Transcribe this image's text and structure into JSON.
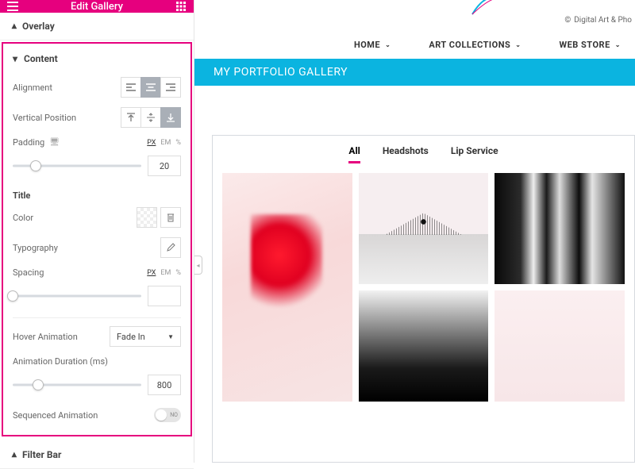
{
  "sidebar": {
    "title": "Edit Gallery",
    "sections": {
      "overlay": "Overlay",
      "content": "Content",
      "filter_bar": "Filter Bar"
    },
    "content": {
      "alignment_label": "Alignment",
      "vertical_position_label": "Vertical Position",
      "padding_label": "Padding",
      "padding_units": {
        "px": "PX",
        "em": "EM",
        "pct": "%"
      },
      "padding_value": "20",
      "title_heading": "Title",
      "color_label": "Color",
      "typography_label": "Typography",
      "spacing_label": "Spacing",
      "spacing_units": {
        "px": "PX",
        "em": "EM",
        "pct": "%"
      },
      "spacing_value": "",
      "hover_animation_label": "Hover Animation",
      "hover_animation_value": "Fade In",
      "animation_duration_label": "Animation Duration (ms)",
      "animation_duration_value": "800",
      "sequenced_label": "Sequenced Animation",
      "sequenced_state": "NO"
    }
  },
  "preview": {
    "copyright": "Digital Art & Pho",
    "nav": {
      "home": "HOME",
      "art": "ART COLLECTIONS",
      "store": "WEB STORE"
    },
    "banner": "MY PORTFOLIO GALLERY",
    "filters": {
      "all": "All",
      "headshots": "Headshots",
      "lip": "Lip Service"
    }
  }
}
